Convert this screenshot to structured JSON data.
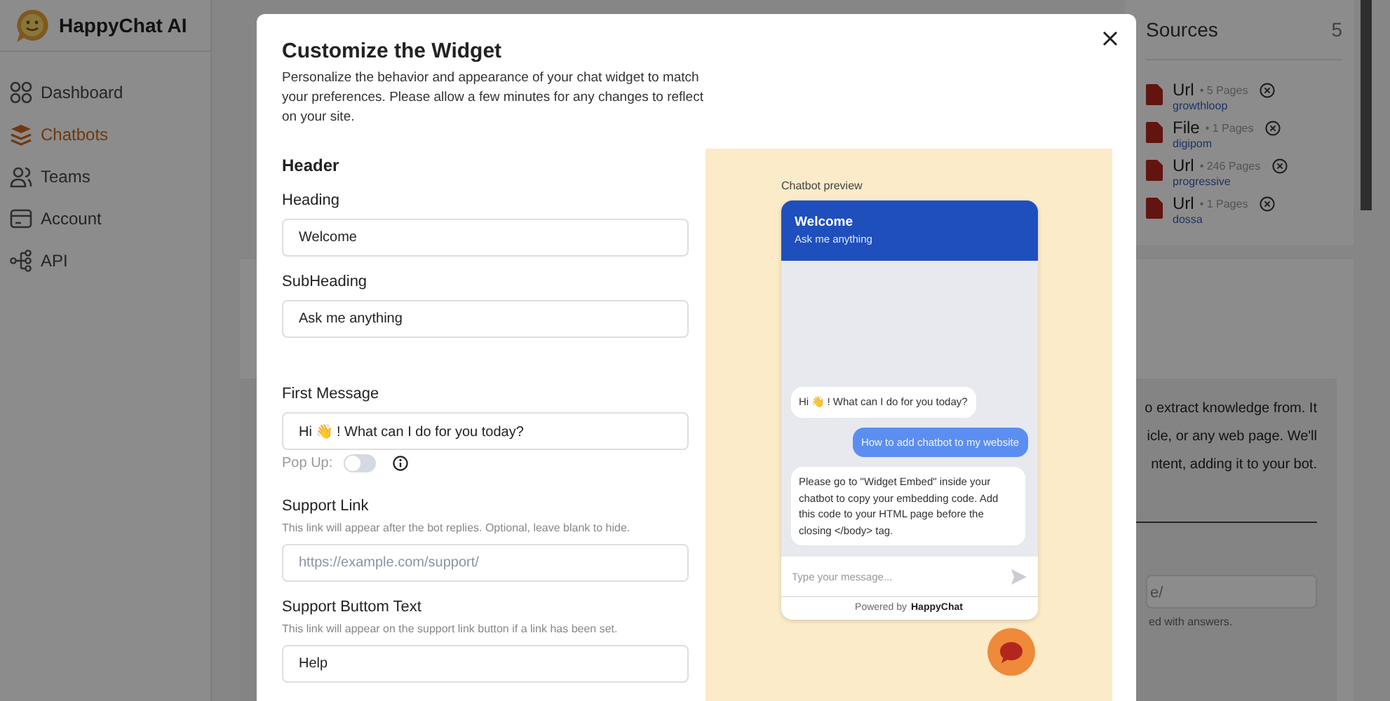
{
  "app": {
    "name": "HappyChat AI"
  },
  "sidebar": {
    "items": [
      {
        "label": "Dashboard",
        "selected": false
      },
      {
        "label": "Chatbots",
        "selected": true
      },
      {
        "label": "Teams",
        "selected": false
      },
      {
        "label": "Account",
        "selected": false
      },
      {
        "label": "API",
        "selected": false
      }
    ]
  },
  "sources": {
    "title": "Sources",
    "count": "5",
    "items": [
      {
        "type": "Url",
        "pages": "• 5 Pages",
        "name": "growthloop"
      },
      {
        "type": "File",
        "pages": "• 1 Pages",
        "name": "digipom"
      },
      {
        "type": "Url",
        "pages": "• 246 Pages",
        "name": "progressive"
      },
      {
        "type": "Url",
        "pages": "• 1 Pages",
        "name": "dossa"
      }
    ]
  },
  "background_card": {
    "lines": [
      "o extract knowledge from. It",
      "icle, or any web page. We'll",
      "ntent, adding it to your bot."
    ],
    "field_value": "e/",
    "hint": "ed with answers."
  },
  "modal": {
    "title": "Customize the Widget",
    "description": "Personalize the behavior and appearance of your chat widget to match your preferences. Please allow a few minutes for any changes to reflect on your site.",
    "groups": [
      {
        "title": "Header",
        "fields": [
          {
            "kind": "text",
            "label": "Heading",
            "value": "Welcome"
          },
          {
            "kind": "text",
            "label": "SubHeading",
            "value": "Ask me anything"
          }
        ]
      },
      {
        "fields": [
          {
            "kind": "text",
            "label": "First Message",
            "value": "Hi 👋 ! What can I do for you today?"
          },
          {
            "kind": "toggle",
            "label": "Pop Up:",
            "on": false
          },
          {
            "kind": "text",
            "label": "Support Link",
            "hint": "This link will appear after the bot replies. Optional, leave blank to hide.",
            "placeholder": "https://example.com/support/"
          },
          {
            "kind": "text",
            "label": "Support Buttom Text",
            "hint": "This link will appear on the support link button if a link has been set.",
            "value": "Help"
          }
        ]
      }
    ],
    "preview": {
      "label": "Chatbot preview",
      "heading": "Welcome",
      "subheading": "Ask me anything",
      "messages": [
        {
          "kind": "bot",
          "text": "Hi 👋 ! What can I do for you today?"
        },
        {
          "kind": "user",
          "text": "How to add chatbot to my website"
        },
        {
          "kind": "bot",
          "text": "Please go to \"Widget Embed\" inside your chatbot to copy your embedding code. Add this code to your HTML page before the closing </body> tag."
        }
      ],
      "input_placeholder": "Type your message...",
      "powered_by": "Powered by",
      "brand": "HappyChat"
    }
  }
}
